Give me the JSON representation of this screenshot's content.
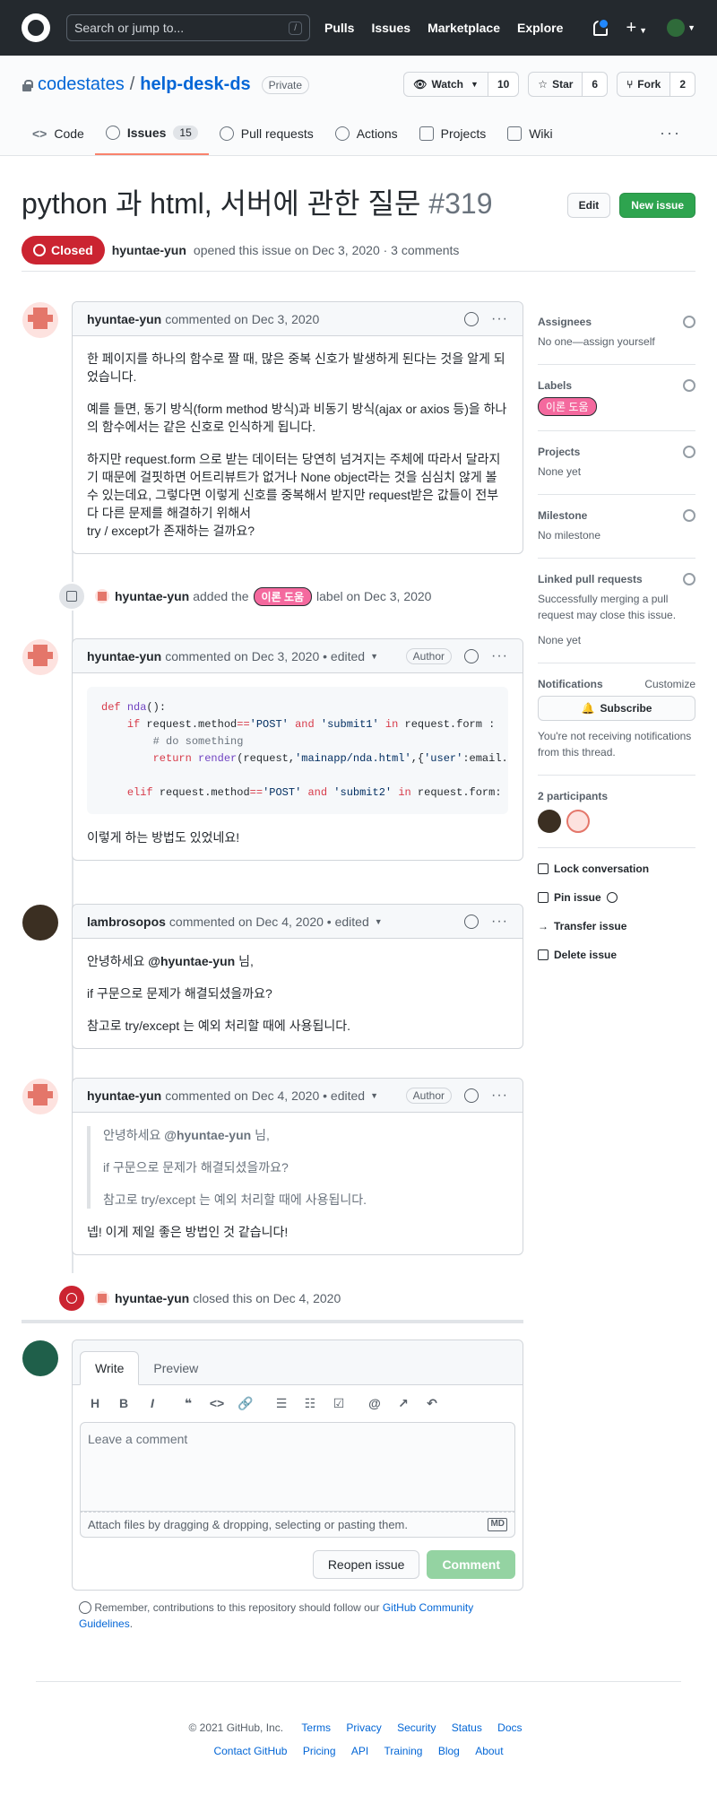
{
  "header": {
    "search_placeholder": "Search or jump to...",
    "search_shortcut": "/",
    "nav": [
      "Pulls",
      "Issues",
      "Marketplace",
      "Explore"
    ],
    "plus": "+"
  },
  "repo": {
    "owner": "codestates",
    "slash": "/",
    "name": "help-desk-ds",
    "visibility": "Private",
    "watch_label": "Watch",
    "watch_count": "10",
    "star_label": "Star",
    "star_count": "6",
    "fork_label": "Fork",
    "fork_count": "2"
  },
  "tabs": [
    {
      "label": "Code"
    },
    {
      "label": "Issues",
      "count": "15"
    },
    {
      "label": "Pull requests"
    },
    {
      "label": "Actions"
    },
    {
      "label": "Projects"
    },
    {
      "label": "Wiki"
    }
  ],
  "tabs_more": "···",
  "issue": {
    "title": "python 과 html, 서버에 관한 질문",
    "number": "#319",
    "state": "Closed",
    "author": "hyuntae-yun",
    "meta_text": "opened this issue on Dec 3, 2020 · 3 comments",
    "edit_label": "Edit",
    "new_issue_label": "New issue"
  },
  "comments": [
    {
      "author": "hyuntae-yun",
      "when": "commented on Dec 3, 2020",
      "paragraphs": [
        "한 페이지를 하나의 함수로 짤 때, 많은 중복 신호가 발생하게 된다는 것을 알게 되었습니다.",
        "예를 들면, 동기 방식(form method 방식)과 비동기 방식(ajax or axios 등)을 하나의 함수에서는 같은 신호로 인식하게 됩니다.",
        "하지만 request.form 으로 받는 데이터는 당연히 넘겨지는 주체에 따라서 달라지기 때문에 걸핏하면 어트리뷰트가 없거나 None object라는 것을 심심치 않게 볼 수 있는데요, 그렇다면 이렇게 신호를 중복해서 받지만 request받은 값들이 전부다 다른 문제를 해결하기 위해서",
        "try / except가 존재하는 걸까요?"
      ]
    },
    {
      "author": "hyuntae-yun",
      "when": "commented on Dec 3, 2020 • edited",
      "badge": "Author",
      "code": [
        "def nda():",
        "    if request.method=='POST' and 'submit1' in request.form :",
        "        # do something",
        "        return render(request,'mainapp/nda.html',{'user':email.s",
        "",
        "    elif request.method=='POST' and 'submit2' in request.form:"
      ],
      "paragraphs": [
        "이렇게 하는 방법도 있었네요!"
      ]
    },
    {
      "author": "lambrosopos",
      "when": "commented on Dec 4, 2020 • edited",
      "greet_pre": "안녕하세요 ",
      "mention": "@hyuntae-yun",
      "greet_post": " 님,",
      "paragraphs": [
        "if 구문으로 문제가 해결되셨을까요?",
        "참고로 try/except 는 예외 처리할 때에 사용됩니다."
      ]
    },
    {
      "author": "hyuntae-yun",
      "when": "commented on Dec 4, 2020 • edited",
      "badge": "Author",
      "quote_greet_pre": "안녕하세요 ",
      "quote_mention": "@hyuntae-yun",
      "quote_greet_post": " 님,",
      "quote": [
        "if 구문으로 문제가 해결되셨을까요?",
        "참고로 try/except 는 예외 처리할 때에 사용됩니다."
      ],
      "paragraphs": [
        "넵! 이게 제일 좋은 방법인 것 같습니다!"
      ]
    }
  ],
  "events": {
    "label_added": {
      "actor": "hyuntae-yun",
      "pre": "added the",
      "label": "이론 도움",
      "post": "label on Dec 3, 2020"
    },
    "closed": {
      "actor": "hyuntae-yun",
      "text": "closed this on Dec 4, 2020"
    }
  },
  "composer": {
    "write_tab": "Write",
    "preview_tab": "Preview",
    "toolbar": [
      "H",
      "B",
      "I",
      "❝",
      "<>",
      "🔗",
      "☰",
      "☷",
      "☑",
      "@",
      "↗",
      "↶"
    ],
    "placeholder": "Leave a comment",
    "attach_text": "Attach files by dragging & dropping, selecting or pasting them.",
    "md_badge": "MD",
    "reopen_label": "Reopen issue",
    "comment_label": "Comment",
    "remember_text": "Remember, contributions to this repository should follow our ",
    "remember_link": "GitHub Community Guidelines",
    "remember_end": "."
  },
  "sidebar": {
    "assignees_title": "Assignees",
    "assignees_value": "No one—assign yourself",
    "labels_title": "Labels",
    "label": "이론 도움",
    "projects_title": "Projects",
    "projects_value": "None yet",
    "milestone_title": "Milestone",
    "milestone_value": "No milestone",
    "linked_title": "Linked pull requests",
    "linked_desc": "Successfully merging a pull request may close this issue.",
    "linked_value": "None yet",
    "notifications_title": "Notifications",
    "customize": "Customize",
    "subscribe": "Subscribe",
    "notif_desc": "You're not receiving notifications from this thread.",
    "participants_title": "2 participants",
    "actions": [
      "Lock conversation",
      "Pin issue",
      "Transfer issue",
      "Delete issue"
    ]
  },
  "footer": {
    "copyright": "© 2021 GitHub, Inc.",
    "row1": [
      "Terms",
      "Privacy",
      "Security",
      "Status",
      "Docs"
    ],
    "row2": [
      "Contact GitHub",
      "Pricing",
      "API",
      "Training",
      "Blog",
      "About"
    ]
  },
  "colors": {
    "closed_red": "#cb2431",
    "green": "#2ea44f",
    "label_pink": "#f4699e",
    "link": "#0366d6"
  }
}
